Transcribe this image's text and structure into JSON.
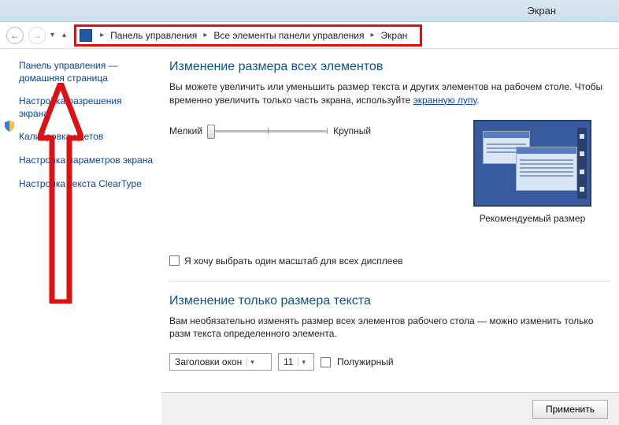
{
  "window": {
    "title": "Экран"
  },
  "breadcrumb": {
    "items": [
      "Панель управления",
      "Все элементы панели управления",
      "Экран"
    ]
  },
  "sidebar": {
    "items": [
      "Панель управления — домашняя страница",
      "Настройка разрешения экрана",
      "Калибровка цветов",
      "Настройка параметров экрана",
      "Настройка текста ClearType"
    ]
  },
  "main": {
    "section1_title": "Изменение размера всех элементов",
    "section1_desc_a": "Вы можете увеличить или уменьшить размер текста и других элементов на рабочем столе. Чтобы временно увеличить только часть экрана, используйте ",
    "section1_link": "экранную лупу",
    "section1_desc_b": ".",
    "slider_min": "Мелкий",
    "slider_max": "Крупный",
    "preview_caption": "Рекомендуемый размер",
    "checkbox_label": "Я хочу выбрать один масштаб для всех дисплеев",
    "section2_title": "Изменение только размера текста",
    "section2_desc": "Вам необязательно изменять размер всех элементов рабочего стола — можно изменить только разм текста определенного элемента.",
    "combo_element": "Заголовки окон",
    "combo_size": "11",
    "bold_label": "Полужирный",
    "apply": "Применить"
  }
}
